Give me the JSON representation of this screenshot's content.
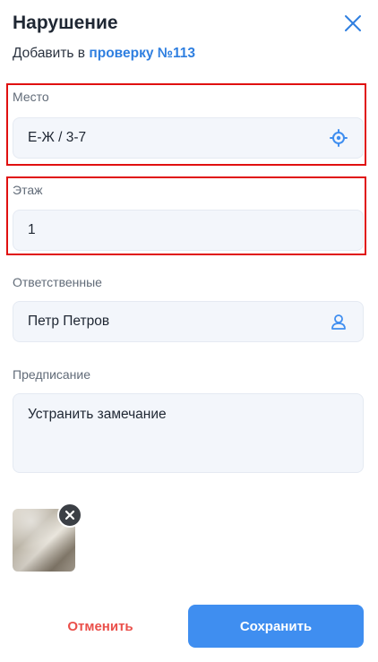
{
  "header": {
    "title": "Нарушение",
    "subtitle_prefix": "Добавить в ",
    "subtitle_link": "проверку №113"
  },
  "form": {
    "place": {
      "label": "Место",
      "value": "Е-Ж / 3-7",
      "icon": "location-target-icon"
    },
    "floor": {
      "label": "Этаж",
      "value": "1"
    },
    "responsible": {
      "label": "Ответственные",
      "value": "Петр Петров",
      "icon": "user-icon"
    },
    "prescription": {
      "label": "Предписание",
      "value": "Устранить замечание"
    }
  },
  "attachments": [
    {
      "type": "photo"
    }
  ],
  "actions": {
    "cancel_label": "Отменить",
    "save_label": "Сохранить"
  },
  "colors": {
    "accent": "#3f8ef0",
    "link": "#2f7fe0",
    "danger": "#ea4f4a",
    "highlight": "#e01010",
    "field_bg": "#f3f6fb"
  }
}
